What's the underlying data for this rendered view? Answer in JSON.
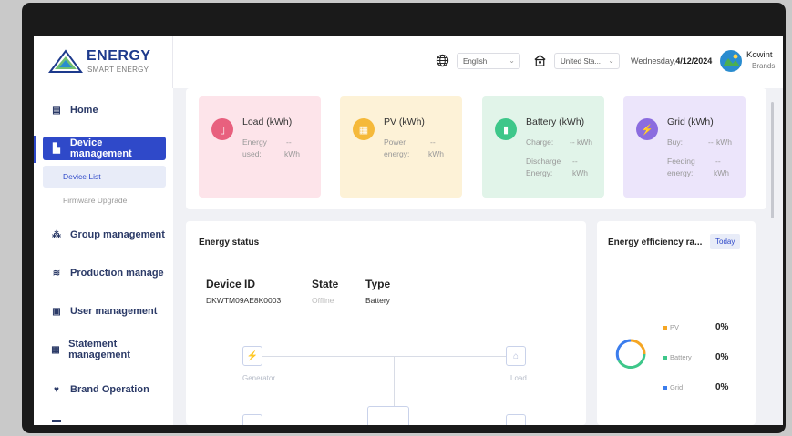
{
  "brand": {
    "name": "ENERGY",
    "tagline": "SMART ENERGY"
  },
  "header": {
    "language": "English",
    "region": "United Sta...",
    "date_prefix": "Wednesday,",
    "date": "4/12/2024",
    "user_name": "Kowint",
    "user_role": "Brands"
  },
  "sidebar": {
    "items": [
      {
        "label": "Home",
        "icon": "home-icon"
      },
      {
        "label": "Device management",
        "icon": "device-icon",
        "active": true
      },
      {
        "label": "Group management",
        "icon": "group-icon"
      },
      {
        "label": "Production manage",
        "icon": "production-icon"
      },
      {
        "label": "User management",
        "icon": "user-icon"
      },
      {
        "label": "Statement management",
        "icon": "statement-icon"
      },
      {
        "label": "Brand Operation",
        "icon": "brand-icon"
      }
    ],
    "subitems": [
      {
        "label": "Device List",
        "selected": true
      },
      {
        "label": "Firmware Upgrade",
        "selected": false
      }
    ]
  },
  "stats": [
    {
      "title": "Load (kWh)",
      "rows": [
        {
          "label1": "Energy",
          "label2": "used:",
          "value": "--",
          "unit": "kWh"
        }
      ],
      "color": "#e8607e",
      "bg": "#fde4ea"
    },
    {
      "title": "PV (kWh)",
      "rows": [
        {
          "label1": "Power",
          "label2": "energy:",
          "value": "--",
          "unit": "kWh"
        }
      ],
      "color": "#f5b93a",
      "bg": "#fdf2d7"
    },
    {
      "title": "Battery (kWh)",
      "rows": [
        {
          "label1": "Charge:",
          "value": "--",
          "unit": "kWh"
        },
        {
          "label1": "Discharge",
          "label2": "Energy:",
          "value": "--",
          "unit": "kWh"
        }
      ],
      "color": "#3ec78a",
      "bg": "#e1f4e9"
    },
    {
      "title": "Grid (kWh)",
      "rows": [
        {
          "label1": "Buy:",
          "value": "--",
          "unit": "kWh"
        },
        {
          "label1": "Feeding",
          "label2": "energy:",
          "value": "--",
          "unit": "kWh"
        }
      ],
      "color": "#8b6cdf",
      "bg": "#ece5fb"
    }
  ],
  "energy_status": {
    "title": "Energy status",
    "columns": [
      "Device ID",
      "State",
      "Type"
    ],
    "device_id": "DKWTM09AE8K0003",
    "state": "Offline",
    "type": "Battery",
    "nodes": {
      "generator": "Generator",
      "load": "Load"
    }
  },
  "efficiency": {
    "title": "Energy efficiency ra...",
    "period": "Today",
    "legend": [
      {
        "label": "PV",
        "value": "0%",
        "color": "#f5a623"
      },
      {
        "label": "Battery",
        "value": "0%",
        "color": "#3ec78a"
      },
      {
        "label": "Grid",
        "value": "0%",
        "color": "#3b7ded"
      }
    ]
  }
}
